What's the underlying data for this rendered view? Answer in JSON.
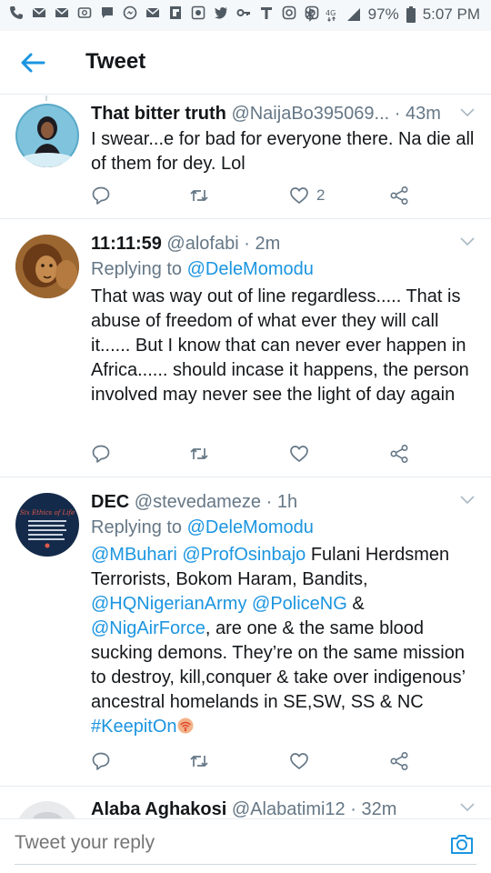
{
  "status_bar": {
    "battery": "97%",
    "time": "5:07 PM"
  },
  "header": {
    "title": "Tweet"
  },
  "tweets": [
    {
      "name": "That bitter truth",
      "handle": "@NaijaBo395069...",
      "time": "· 43m",
      "replying_label": "",
      "replying_to": "",
      "text": "I swear...e for bad for everyone there. Na die all of them for dey. Lol",
      "like_count": "2"
    },
    {
      "name": "11:11:59",
      "handle": "@alofabi",
      "time": "· 2m",
      "replying_label": "Replying to",
      "replying_to": "@DeleMomodu",
      "text": "That was way out of line regardless..... That is abuse of freedom of what ever they will call it...... But I know that can never ever happen in Africa...... should incase it happens, the person involved may never see the light of day again",
      "like_count": ""
    },
    {
      "name": "DEC",
      "handle": "@stevedameze",
      "time": "· 1h",
      "replying_label": "Replying to",
      "replying_to": "@DeleMomodu",
      "mention1": "@MBuhari",
      "mention2": "@ProfOsinbajo",
      "text_a": "Fulani Herdsmen Terrorists, Bokom Haram, Bandits,",
      "mention3": "@HQNigerianArmy",
      "mention4": "@PoliceNG",
      "text_b": "&",
      "mention5": "@NigAirForce",
      "text_c": ", are one & the same blood sucking demons. They’re on the same mission to destroy, kill,conquer & take over indigenous’ ancestral homelands in SE,SW, SS & NC",
      "hashtag": "#KeepitOn",
      "avatar_text": "Six Ethics of Life",
      "like_count": ""
    },
    {
      "name": "Alaba Aghakosi",
      "handle": "@Alabatimi12",
      "time": "· 32m"
    }
  ],
  "reply_bar": {
    "placeholder": "Tweet your reply"
  },
  "colors": {
    "accent": "#1b95e0",
    "text": "#14171a",
    "secondary": "#657786",
    "divider": "#e6ecf0"
  },
  "icons": [
    "phone-icon",
    "mail-icon",
    "mail-icon",
    "gallery-icon",
    "chat-icon",
    "messenger-icon",
    "mail-icon",
    "flipboard-icon",
    "whatsapp-icon",
    "twitter-icon",
    "key-icon",
    "t-icon",
    "instagram-icon",
    "instagram-icon",
    "bluetooth-icon",
    "4g-icon",
    "signal-icon",
    "battery-icon",
    "back-arrow-icon",
    "chevron-down-icon",
    "reply-icon",
    "retweet-icon",
    "like-icon",
    "share-icon",
    "camera-icon",
    "wifi-hashflag-icon"
  ]
}
